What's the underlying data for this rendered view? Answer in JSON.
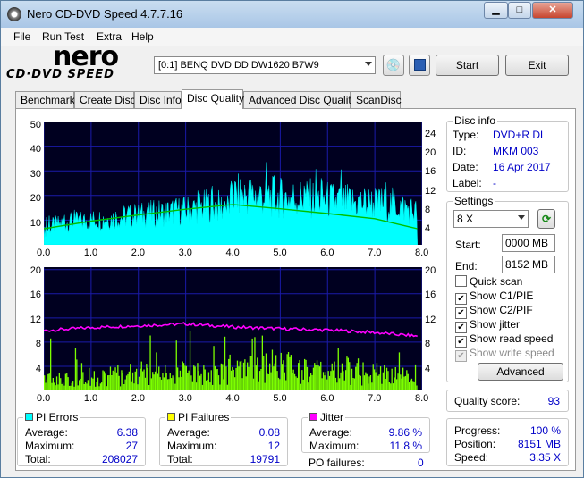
{
  "window": {
    "title": "Nero CD-DVD Speed 4.7.7.16"
  },
  "menu": [
    "File",
    "Run Test",
    "Extra",
    "Help"
  ],
  "logo": {
    "nero": "nero",
    "sub": "CD·DVD SPEED"
  },
  "drive": {
    "selected": "[0:1]   BENQ DVD DD DW1620 B7W9"
  },
  "buttons": {
    "start": "Start",
    "exit": "Exit",
    "advanced": "Advanced"
  },
  "tabs": [
    "Benchmark",
    "Create Disc",
    "Disc Info",
    "Disc Quality",
    "Advanced Disc Quality",
    "ScanDisc"
  ],
  "active_tab": "Disc Quality",
  "disc_info": {
    "title": "Disc info",
    "type_label": "Type:",
    "type": "DVD+R DL",
    "id_label": "ID:",
    "id": "MKM 003",
    "date_label": "Date:",
    "date": "16 Apr 2017",
    "label_label": "Label:",
    "label": "-"
  },
  "settings": {
    "title": "Settings",
    "speed": "8 X",
    "start_label": "Start:",
    "start": "0000 MB",
    "end_label": "End:",
    "end": "8152 MB",
    "quick_scan": "Quick scan",
    "show_c1": "Show C1/PIE",
    "show_c2": "Show C2/PIF",
    "show_jitter": "Show jitter",
    "show_read": "Show read speed",
    "show_write": "Show write speed"
  },
  "quality": {
    "label": "Quality score:",
    "value": "93"
  },
  "progress": {
    "progress_label": "Progress:",
    "progress": "100 %",
    "position_label": "Position:",
    "position": "8151 MB",
    "speed_label": "Speed:",
    "speed": "3.35 X"
  },
  "pi_errors": {
    "title": "PI Errors",
    "color": "#00ffff",
    "avg_label": "Average:",
    "avg": "6.38",
    "max_label": "Maximum:",
    "max": "27",
    "total_label": "Total:",
    "total": "208027"
  },
  "pi_failures": {
    "title": "PI Failures",
    "color": "#ffff00",
    "avg_label": "Average:",
    "avg": "0.08",
    "max_label": "Maximum:",
    "max": "12",
    "total_label": "Total:",
    "total": "19791"
  },
  "jitter": {
    "title": "Jitter",
    "color": "#ff00ff",
    "avg_label": "Average:",
    "avg": "9.86 %",
    "max_label": "Maximum:",
    "max": "11.8 %",
    "po_label": "PO failures:",
    "po": "0"
  },
  "chart_data": [
    {
      "type": "area",
      "x_ticks": [
        "0.0",
        "1.0",
        "2.0",
        "3.0",
        "4.0",
        "5.0",
        "6.0",
        "7.0",
        "8.0"
      ],
      "y_left_ticks": [
        "50",
        "40",
        "30",
        "20",
        "10"
      ],
      "y_right_ticks": [
        "24",
        "20",
        "16",
        "12",
        "8",
        "4"
      ],
      "xlim": [
        0,
        8
      ],
      "ylim": [
        0,
        50
      ],
      "y2lim": [
        0,
        26
      ],
      "pie_profile": [
        [
          0,
          5
        ],
        [
          0.2,
          8
        ],
        [
          0.5,
          9
        ],
        [
          1,
          10
        ],
        [
          1.5,
          11
        ],
        [
          2,
          12
        ],
        [
          2.5,
          13
        ],
        [
          3,
          14
        ],
        [
          3.5,
          16
        ],
        [
          3.9,
          15
        ],
        [
          4,
          20
        ],
        [
          4.5,
          20
        ],
        [
          5,
          19
        ],
        [
          5.5,
          19
        ],
        [
          6,
          18
        ],
        [
          6.5,
          17
        ],
        [
          7,
          17
        ],
        [
          7.5,
          16
        ],
        [
          7.9,
          13
        ]
      ],
      "read_speed": [
        [
          0,
          3.4
        ],
        [
          1,
          5.0
        ],
        [
          2,
          6.3
        ],
        [
          3,
          7.5
        ],
        [
          4,
          8.5
        ],
        [
          5,
          7.6
        ],
        [
          6,
          6.6
        ],
        [
          7,
          5.5
        ],
        [
          7.9,
          3.4
        ]
      ]
    },
    {
      "type": "bar",
      "x_ticks": [
        "0.0",
        "1.0",
        "2.0",
        "3.0",
        "4.0",
        "5.0",
        "6.0",
        "7.0",
        "8.0"
      ],
      "y_left_ticks": [
        "20",
        "16",
        "12",
        "8",
        "4"
      ],
      "y_right_ticks": [
        "20",
        "16",
        "12",
        "8",
        "4"
      ],
      "xlim": [
        0,
        8
      ],
      "ylim": [
        0,
        20
      ],
      "pif_profile": [
        [
          0,
          2
        ],
        [
          1,
          3
        ],
        [
          2,
          3.5
        ],
        [
          3,
          3.5
        ],
        [
          4,
          4
        ],
        [
          5,
          5
        ],
        [
          6,
          4
        ],
        [
          7,
          3.5
        ],
        [
          7.9,
          2.5
        ]
      ],
      "jitter": [
        [
          0,
          9.7
        ],
        [
          1,
          10.2
        ],
        [
          2,
          10.5
        ],
        [
          3,
          10.8
        ],
        [
          4,
          10.3
        ],
        [
          5,
          10.0
        ],
        [
          6,
          9.8
        ],
        [
          7,
          9.4
        ],
        [
          7.9,
          8.8
        ]
      ]
    }
  ]
}
